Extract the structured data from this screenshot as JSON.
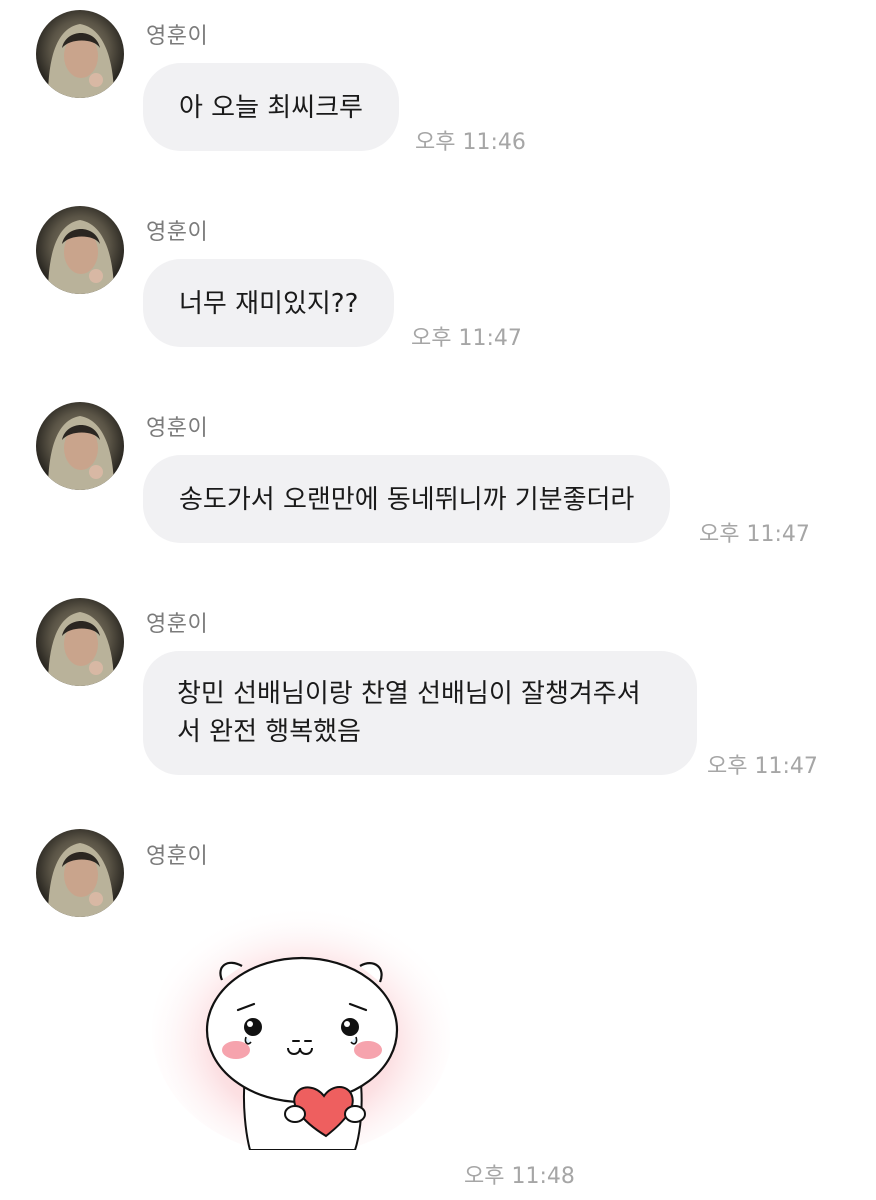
{
  "chat": {
    "sender_name": "영훈이",
    "messages": [
      {
        "text": "아 오늘 최씨크루",
        "time": "오후 11:46"
      },
      {
        "text": "너무 재미있지??",
        "time": "오후 11:47"
      },
      {
        "text": "송도가서 오랜만에 동네뛰니까 기분좋더라",
        "time": "오후 11:47"
      },
      {
        "text": "창민 선배님이랑 찬열 선배님이 잘챙겨주셔서 완전 행복했음",
        "time": "오후 11:47"
      }
    ],
    "sticker": {
      "icon": "crying-hamster-heart-sticker",
      "time": "오후 11:48"
    }
  },
  "colors": {
    "bubble": "#f1f1f3",
    "time": "#a6a6a6",
    "name": "#7b7b7b",
    "heart": "#ee5f5f",
    "blush": "#f6a3ad"
  }
}
